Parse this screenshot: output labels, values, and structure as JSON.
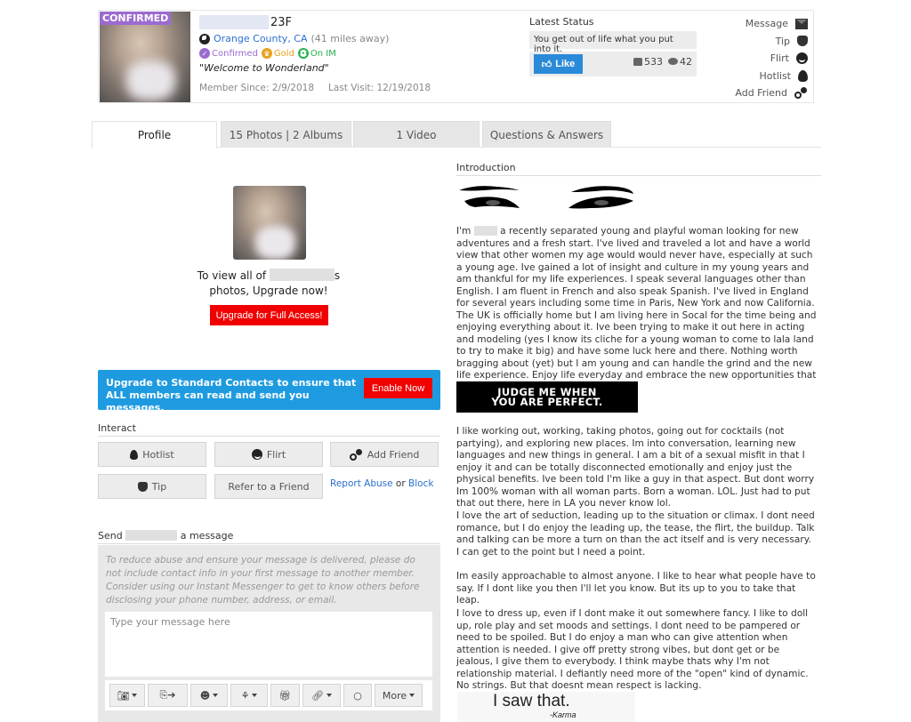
{
  "profile": {
    "confirmed_badge": "CONFIRMED",
    "age_gender": "23F",
    "location": "Orange County, CA",
    "distance": "(41 miles away)",
    "badges": [
      {
        "label": "Confirmed",
        "icon": "check-icon",
        "color": "#9b6bd0"
      },
      {
        "label": "Gold",
        "icon": "crown-icon",
        "color": "#e6a11f"
      },
      {
        "label": "On IM",
        "icon": "chat-icon",
        "color": "#23b14d"
      }
    ],
    "quote_open": "\"",
    "quote": "Welcome to Wonderland",
    "quote_close": "\"",
    "member_since": "Member Since: 2/9/2018",
    "last_visit": "Last Visit: 12/19/2018"
  },
  "status": {
    "title": "Latest Status",
    "text": "You get out of life what you put into it.",
    "like_label": "Like",
    "likes": "533",
    "comments": "42"
  },
  "side_actions": [
    {
      "label": "Message",
      "icon": "envelope-icon"
    },
    {
      "label": "Tip",
      "icon": "coins-icon"
    },
    {
      "label": "Flirt",
      "icon": "wink-icon"
    },
    {
      "label": "Hotlist",
      "icon": "flame-icon"
    },
    {
      "label": "Add Friend",
      "icon": "add-friend-icon"
    }
  ],
  "tabs": [
    {
      "label": "Profile",
      "active": true
    },
    {
      "label": "15 Photos | 2 Albums",
      "active": false
    },
    {
      "label": "1 Video",
      "active": false
    },
    {
      "label": "Questions & Answers",
      "active": false
    }
  ],
  "photos": {
    "view_all_prefix": "To view all of",
    "view_all_suffix": "s",
    "view_all_line2": "photos, Upgrade now!",
    "upgrade_button": "Upgrade for Full Access!"
  },
  "promo": {
    "text": "Upgrade to Standard Contacts to ensure that ALL members can read and send you messages.",
    "button": "Enable Now"
  },
  "interact": {
    "title": "Interact",
    "buttons": [
      {
        "label": "Hotlist",
        "icon": "flame-icon"
      },
      {
        "label": "Flirt",
        "icon": "wink-icon"
      },
      {
        "label": "Add Friend",
        "icon": "add-friend-icon"
      },
      {
        "label": "Tip",
        "icon": "coins-icon"
      },
      {
        "label": "Refer to a Friend",
        "icon": ""
      }
    ],
    "report_abuse": "Report Abuse",
    "or": "or",
    "block": "Block"
  },
  "message": {
    "title_prefix": "Send",
    "title_suffix": "a message",
    "notice": "To reduce abuse and ensure your message is delivered, please do not include contact info in your first message to another member. Consider using our Instant Messenger to get to know others before disclosing your phone number, address, or email.",
    "placeholder": "Type your message here",
    "toolbar": [
      {
        "icon": "camera-icon",
        "dropdown": true
      },
      {
        "icon": "share-photo-icon",
        "dropdown": false
      },
      {
        "icon": "smiley-icon",
        "dropdown": true
      },
      {
        "icon": "flower-icon",
        "dropdown": true
      },
      {
        "icon": "gift-icon",
        "dropdown": false
      },
      {
        "icon": "link-icon",
        "dropdown": true
      },
      {
        "icon": "ring-icon",
        "dropdown": false
      }
    ],
    "more_label": "More"
  },
  "intro": {
    "title": "Introduction",
    "p1_prefix": "I'm",
    "p1": "a recently separated young and playful woman looking for new adventures and a fresh start. I've lived and traveled a lot and have a world view that other women my age would would never have, especially at such a young age. Ive gained a lot of insight and culture in my young years and am thankful for my life experiences. I speak several languages other than English. I am fluent in French and also speak Spanish. I've lived in England for several years including some time in Paris, New York and now California. The UK is officially home but I am living here in Socal for the time being and enjoying everything about it. Ive been trying to make it out here in acting and modeling (yes I know its cliche for a young woman to come to lala land to try to make it big) and have some luck here and there. Nothing worth bragging about (yet) but I am young and can handle the grind and the new life experience. Enjoy life everyday and embrace the new opportunities that it comes with.",
    "judge_line1": "JUDGE ME WHEN",
    "judge_line2": "YOU ARE PERFECT.",
    "p2": "I like working out, working, taking photos, going out for cocktails (not partying), and exploring new places. Im into conversation, learning new languages and new things in general. I am a bit of a sexual misfit in that I enjoy it and can be totally disconnected emotionally and enjoy just the physical benefits. Ive been told I'm like a guy in that aspect. But dont worry Im 100% woman with all woman parts. Born a woman. LOL. Just had to put that out there, here in LA you never know lol.",
    "p3": "I love the art of seduction, leading up to the situation or climax. I dont need romance, but I do enjoy the leading up, the tease, the flirt, the buildup. Talk and talking can be more a turn on than the act itself and is very necessary. I can get to the point but I need a point.",
    "p4": "Im easily approachable to almost anyone. I like to hear what people have to say. If I dont like you then I'll let you know. But its up to you to take that leap.",
    "p5": "I love to dress up, even if I dont make it out somewhere fancy. I like to doll up, role play and set moods and settings. I dont need to be pampered or need to be spoiled. But I do enjoy a man who can give attention when attention is needed. I give off pretty strong vibes, but dont get or be jealous, I give them to everybody. I think maybe thats why I'm not relationship material. I defiantly need more of the \"open\" kind of dynamic. No strings. But that doesnt mean respect is lacking.",
    "saw_main": "I saw that.",
    "saw_sub": "-Karma"
  }
}
